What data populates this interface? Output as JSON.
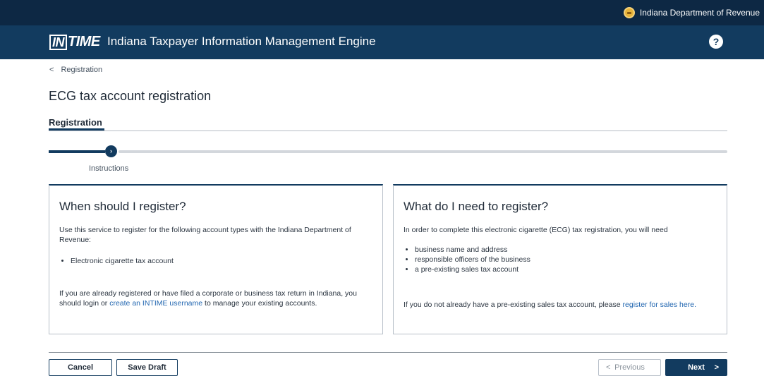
{
  "topbar": {
    "agency": "Indiana Department of Revenue"
  },
  "header": {
    "logo_in": "IN",
    "logo_time": "TIME",
    "title": "Indiana Taxpayer Information Management Engine",
    "help": "?"
  },
  "breadcrumb": {
    "back": "<",
    "label": "Registration"
  },
  "page": {
    "title": "ECG tax account registration"
  },
  "tab": {
    "label": "Registration"
  },
  "stepper": {
    "icon": "›",
    "step_label": "Instructions"
  },
  "left_card": {
    "heading": "When should I register?",
    "intro": "Use this service to register for the following account types with the Indiana Department of Revenue:",
    "items": [
      "Electronic cigarette tax account"
    ],
    "outro_prefix": "If you are already registered or have filed a corporate or business tax return in Indiana, you should login or ",
    "outro_link": "create an INTIME username",
    "outro_suffix": " to manage your existing accounts."
  },
  "right_card": {
    "heading": "What do I need to register?",
    "intro": "In order to complete this electronic cigarette (ECG) tax registration, you will need",
    "items": [
      "business name and address",
      "responsible officers of the business",
      "a pre-existing sales tax account"
    ],
    "outro_prefix": "If you do not already have a pre-existing sales tax account, please ",
    "outro_link": "register for sales here."
  },
  "footer": {
    "cancel": "Cancel",
    "save_draft": "Save Draft",
    "previous": "Previous",
    "previous_icon": "<",
    "next": "Next",
    "next_icon": ">"
  }
}
